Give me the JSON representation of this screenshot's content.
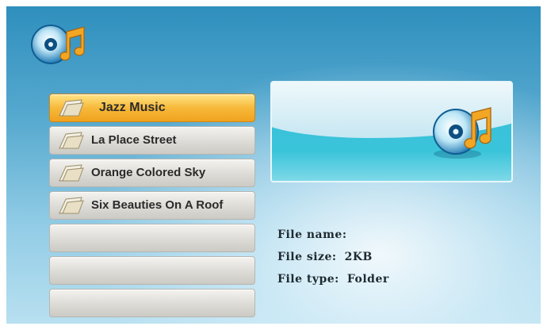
{
  "app": {
    "logo": "music-cd-icon"
  },
  "file_list": {
    "items": [
      {
        "label": "Jazz Music",
        "icon": "folder-icon",
        "selected": true
      },
      {
        "label": "La Place Street",
        "icon": "folder-icon",
        "selected": false
      },
      {
        "label": "Orange Colored Sky",
        "icon": "folder-icon",
        "selected": false
      },
      {
        "label": "Six Beauties On A Roof",
        "icon": "folder-icon",
        "selected": false
      },
      {
        "label": "",
        "icon": "",
        "selected": false
      },
      {
        "label": "",
        "icon": "",
        "selected": false
      },
      {
        "label": "",
        "icon": "",
        "selected": false
      }
    ]
  },
  "preview": {
    "icon": "music-cd-icon"
  },
  "info": {
    "file_name_label": "File name:",
    "file_name_value": "",
    "file_size_label": "File size:",
    "file_size_value": "2KB",
    "file_type_label": "File type:",
    "file_type_value": "Folder"
  },
  "colors": {
    "background": "#4aa3cc",
    "selected": "#f7b93a",
    "item": "#dcdbd6",
    "preview": "#38c0d8"
  }
}
